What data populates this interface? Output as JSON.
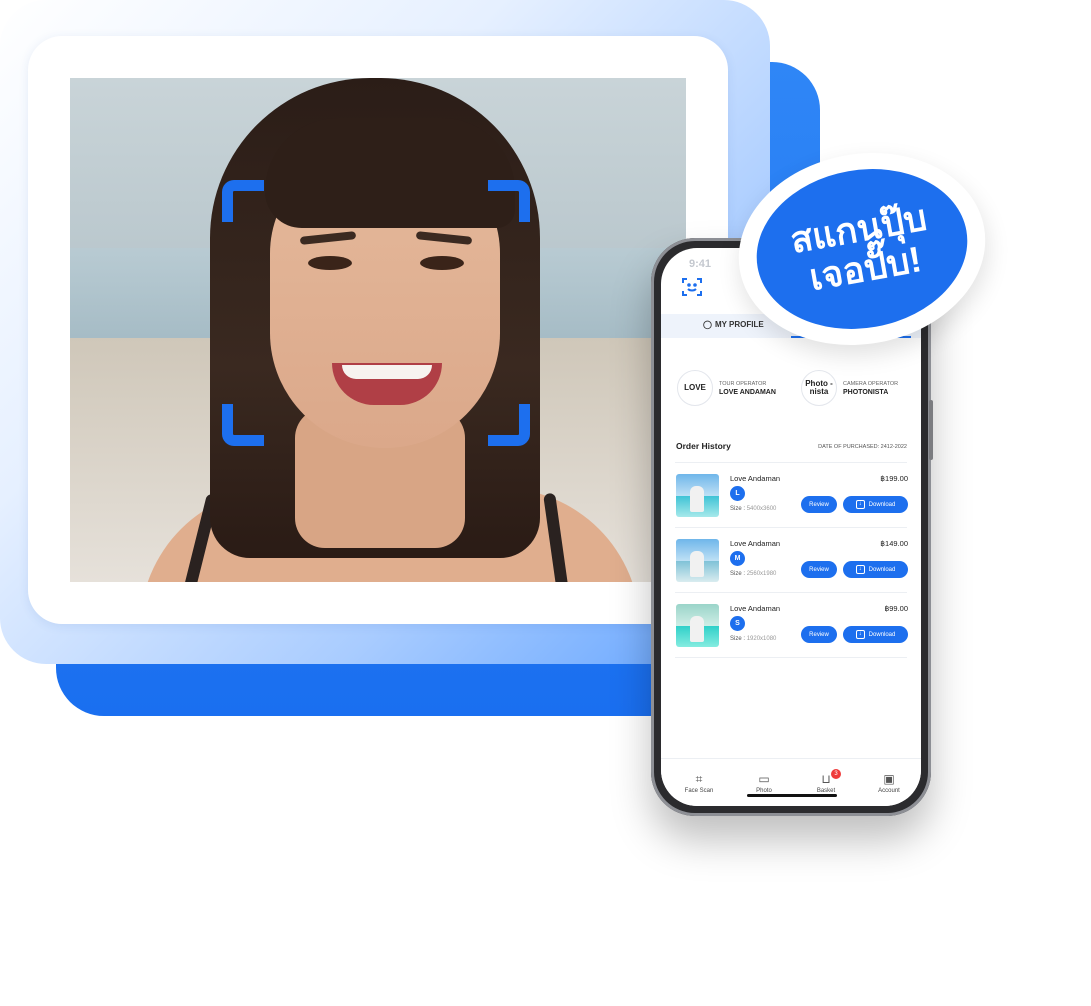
{
  "bubble": {
    "line1": "สแกนปุ๊บ",
    "line2": "เจอปั๊บ!"
  },
  "phone": {
    "status_time": "9:41",
    "tab_profile": "MY PROFILE",
    "operators": [
      {
        "role": "TOUR OPERATOR",
        "name": "LOVE ANDAMAN",
        "logo_text": "LOVE"
      },
      {
        "role": "CAMERA OPERATOR",
        "name": "PHOTONISTA",
        "logo_text": "Photo -nista"
      }
    ],
    "order_history_title": "Order History",
    "order_date": "DATE OF PURCHASED: 2412-2022",
    "orders": [
      {
        "name": "Love Andaman",
        "size_letter": "L",
        "size_label": "Size :",
        "size_value": "5400x3600",
        "price": "฿199.00",
        "review": "Review",
        "download": "Download"
      },
      {
        "name": "Love Andaman",
        "size_letter": "M",
        "size_label": "Size :",
        "size_value": "2560x1980",
        "price": "฿149.00",
        "review": "Review",
        "download": "Download"
      },
      {
        "name": "Love Andaman",
        "size_letter": "S",
        "size_label": "Size :",
        "size_value": "1920x1080",
        "price": "฿99.00",
        "review": "Review",
        "download": "Download"
      }
    ],
    "nav": [
      {
        "label": "Face Scan",
        "icon": "face-scan-icon"
      },
      {
        "label": "Photo",
        "icon": "image-icon"
      },
      {
        "label": "Basket",
        "icon": "cart-icon",
        "badge": "3"
      },
      {
        "label": "Account",
        "icon": "account-icon"
      }
    ]
  },
  "colors": {
    "accent": "#1d6fee",
    "badge": "#ef3b3b"
  }
}
